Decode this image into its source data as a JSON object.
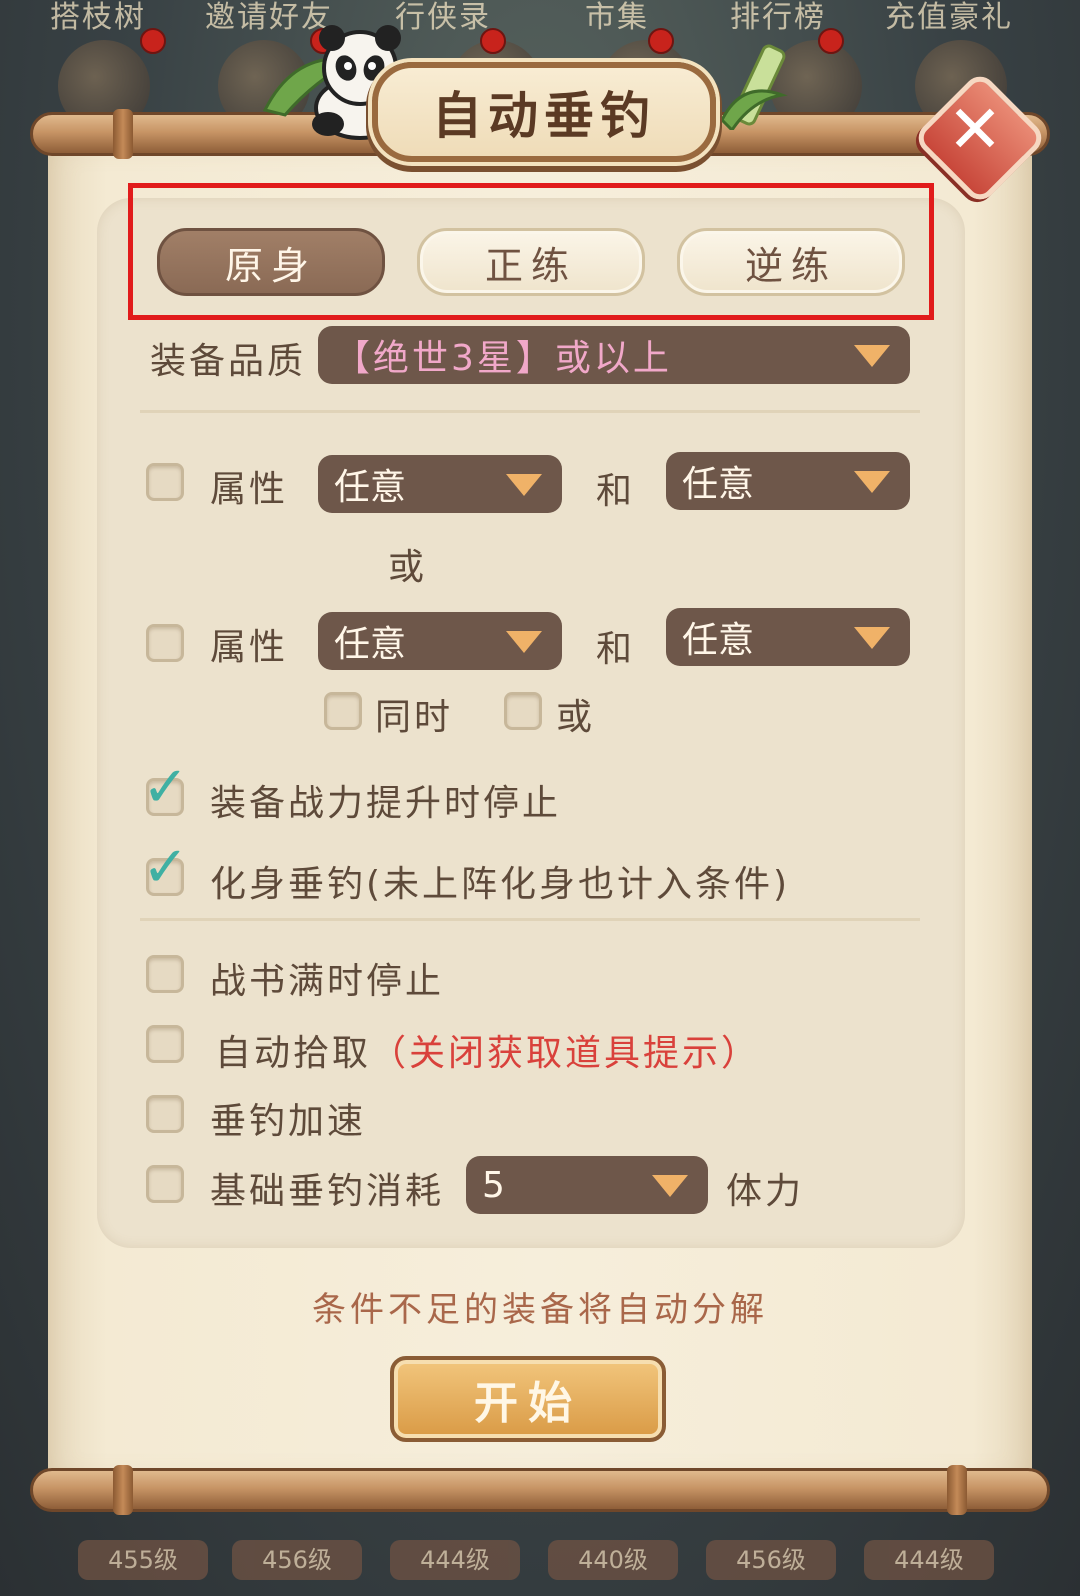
{
  "background": {
    "top_labels": [
      "搭枝树",
      "邀请好友",
      "行侠录",
      "市集",
      "排行榜",
      "充值豪礼"
    ],
    "bottom_labels": [
      "455级",
      "456级",
      "444级",
      "440级",
      "456级",
      "444级"
    ]
  },
  "dialog": {
    "title": "自动垂钓",
    "close_symbol": "✕",
    "tabs": [
      {
        "label": "原身",
        "active": true
      },
      {
        "label": "正练",
        "active": false
      },
      {
        "label": "逆练",
        "active": false
      }
    ],
    "quality": {
      "label": "装备品质",
      "value": "【绝世3星】或以上"
    },
    "attr_row_1": {
      "checked": false,
      "label": "属性",
      "first_value": "任意",
      "connector": "和",
      "second_value": "任意"
    },
    "or_label": "或",
    "attr_row_2": {
      "checked": false,
      "label": "属性",
      "first_value": "任意",
      "connector": "和",
      "second_value": "任意"
    },
    "mode_options": [
      {
        "label": "同时",
        "checked": false
      },
      {
        "label": "或",
        "checked": false
      }
    ],
    "options_checked": [
      {
        "label": "装备战力提升时停止",
        "checked": true
      },
      {
        "label": "化身垂钓(未上阵化身也计入条件)",
        "checked": true
      }
    ],
    "options_other": {
      "war_book": {
        "label": "战书满时停止",
        "checked": false
      },
      "auto_pickup": {
        "label": "自动拾取",
        "note": "（关闭获取道具提示）",
        "checked": false
      },
      "speed_up": {
        "label": "垂钓加速",
        "checked": false
      },
      "base_cost": {
        "label": "基础垂钓消耗",
        "value": "5",
        "unit": "体力",
        "checked": false
      }
    },
    "hint": "条件不足的装备将自动分解",
    "start_label": "开始"
  },
  "colors": {
    "active_tab": "#8a6a55",
    "dropdown": "#6e574a",
    "quality_text": "#f1a8c9",
    "highlight": "#e11b1b",
    "check": "#3fb0a3",
    "note_red": "#d9413b",
    "start_button": "#d99a45"
  },
  "icons": {
    "close": "close-icon",
    "dropdown": "chevron-down-icon",
    "check": "checkmark-icon",
    "mascot": "panda-icon"
  }
}
